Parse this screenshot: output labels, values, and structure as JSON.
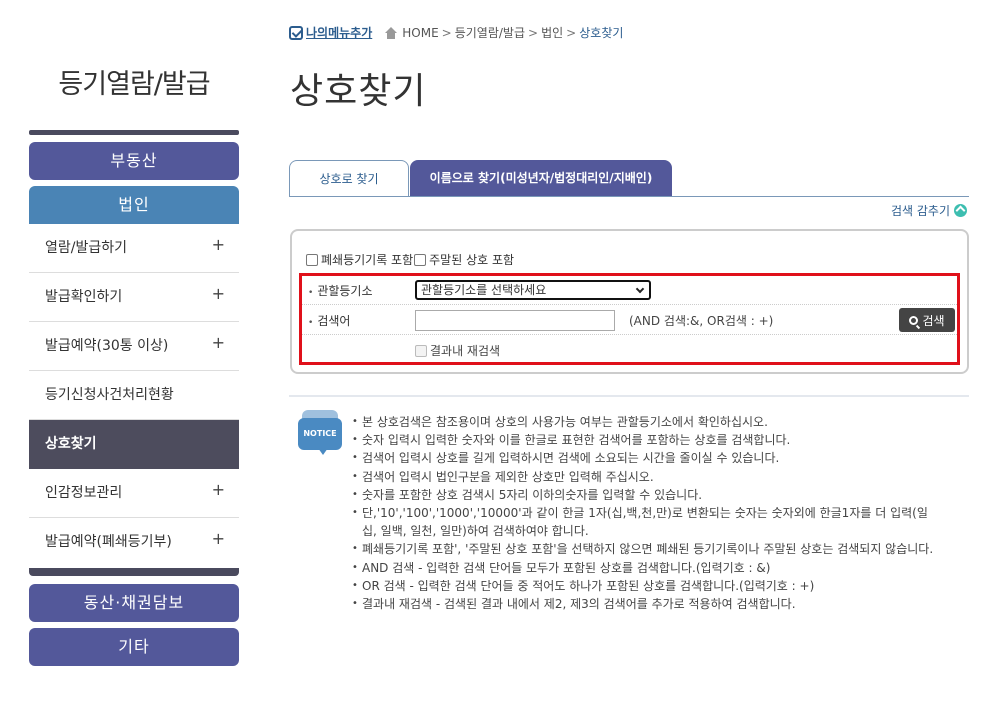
{
  "sidebar": {
    "title": "등기열람/발급",
    "main_buttons": {
      "real_estate": "부동산",
      "corporation": "법인",
      "movable": "동산·채권담보",
      "etc": "기타"
    },
    "items": [
      {
        "label": "열람/발급하기",
        "plus": "+"
      },
      {
        "label": "발급확인하기",
        "plus": "+"
      },
      {
        "label": "발급예약(30통 이상)",
        "plus": "+"
      },
      {
        "label": "등기신청사건처리현황",
        "plus": ""
      },
      {
        "label": "상호찾기",
        "plus": ""
      },
      {
        "label": "인감정보관리",
        "plus": "+"
      },
      {
        "label": "발급예약(폐쇄등기부)",
        "plus": "+"
      }
    ]
  },
  "breadcrumb": {
    "mymenu": "나의메뉴추가",
    "home": "HOME",
    "level1": "등기열람/발급",
    "level2": "법인",
    "current": "상호찾기",
    "sep": ">"
  },
  "page_title": "상호찾기",
  "tabs": {
    "tab1": "상호로 찾기",
    "tab2": "이름으로 찾기(미성년자/법정대리인/지배인)"
  },
  "collapse_label": "검색 감추기",
  "search": {
    "chk_closed": "폐쇄등기기록 포함",
    "chk_dormant": "주말된 상호 포함",
    "registry_label": "관할등기소",
    "registry_select": "관할등기소를 선택하세요",
    "keyword_label": "검색어",
    "keyword_value": "",
    "hint": "(AND 검색:&, OR검색 : +)",
    "search_button": "검색",
    "research_label": "결과내 재검색"
  },
  "notice": {
    "icon_text": "NOTICE",
    "items": [
      "본 상호검색은 참조용이며 상호의 사용가능 여부는 관할등기소에서 확인하십시오.",
      "숫자 입력시 입력한 숫자와 이를 한글로 표현한 검색어를 포함하는 상호를 검색합니다.",
      "검색어 입력시 상호를 길게 입력하시면 검색에 소요되는 시간을 줄이실 수 있습니다.",
      "검색어 입력시 법인구분을 제외한 상호만 입력해 주십시오.",
      "숫자를 포함한 상호 검색시 5자리 이하의숫자를 입력할 수 있습니다.",
      "단,'10','100','1000','10000'과 같이 한글 1자(십,백,천,만)로 변환되는 숫자는 숫자외에 한글1자를 더 입력(일십, 일백, 일천, 일만)하여 검색하여야 합니다.",
      "폐쇄등기기록 포함', '주말된 상호 포함'을 선택하지 않으면 폐쇄된 등기기록이나 주말된 상호는 검색되지 않습니다.",
      "AND 검색 - 입력한 검색 단어들 모두가 포함된 상호를 검색합니다.(입력기호 : &)",
      "OR 검색 - 입력한 검색 단어들 중 적어도 하나가 포함된 상호를 검색합니다.(입력기호 : +)",
      "결과내 재검색 - 검색된 결과 내에서 제2, 제3의 검색어를 추가로 적용하여 검색합니다."
    ]
  }
}
